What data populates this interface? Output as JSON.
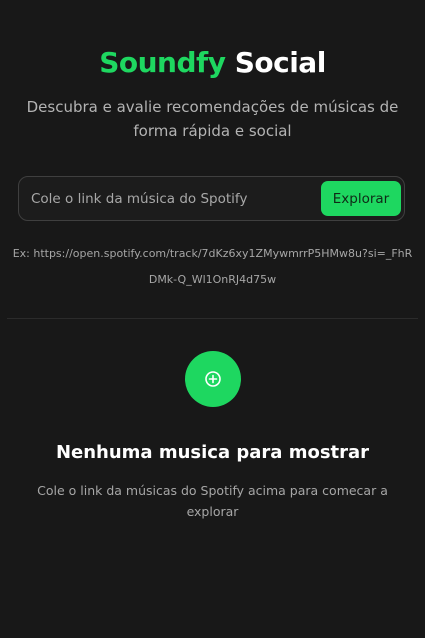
{
  "header": {
    "title_brand": "Soundfy",
    "title_rest": "Social",
    "subtitle": "Descubra e avalie recomendações de músicas de forma rápida e social"
  },
  "search": {
    "placeholder": "Cole o link da música do Spotify",
    "value": "",
    "button_label": "Explorar",
    "example": "Ex: https://open.spotify.com/track/7dKz6xy1ZMywmrrP5HMw8u?si=_FhRDMk-Q_Wl1OnRJ4d75w"
  },
  "empty_state": {
    "icon": "plus-circle-icon",
    "title": "Nenhuma musica para mostrar",
    "description": "Cole o link da músicas do Spotify acima para comecar a explorar"
  },
  "colors": {
    "background": "#181818",
    "accent": "#1ed760",
    "text_primary": "#ffffff",
    "text_secondary": "#b3b3b3"
  }
}
